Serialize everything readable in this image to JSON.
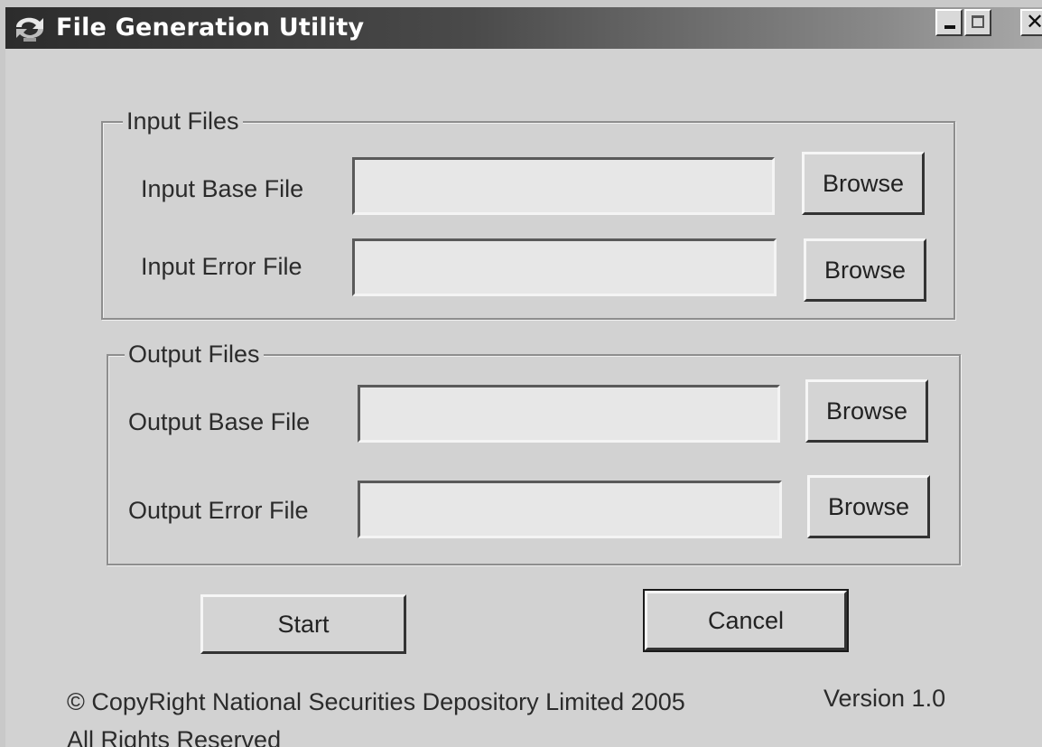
{
  "window": {
    "title": "File Generation Utility",
    "controls": {
      "minimize": "minimize-icon",
      "maximize": "maximize-icon",
      "close": "close-icon"
    }
  },
  "input_group": {
    "legend": "Input Files",
    "base_label": "Input Base File",
    "base_value": "",
    "error_label": "Input Error File",
    "error_value": "",
    "browse_label": "Browse"
  },
  "output_group": {
    "legend": "Output Files",
    "base_label": "Output Base File",
    "base_value": "",
    "error_label": "Output Error File",
    "error_value": "",
    "browse_label": "Browse"
  },
  "actions": {
    "start_label": "Start",
    "cancel_label": "Cancel"
  },
  "footer": {
    "copyright": "© CopyRight National Securities Depository Limited 2005",
    "version": "Version 1.0",
    "rights": "All Rights Reserved"
  },
  "colors": {
    "titlebar_start": "#2c2c2c",
    "window_bg": "#d2d2d2",
    "field_bg": "#e7e7e7"
  }
}
